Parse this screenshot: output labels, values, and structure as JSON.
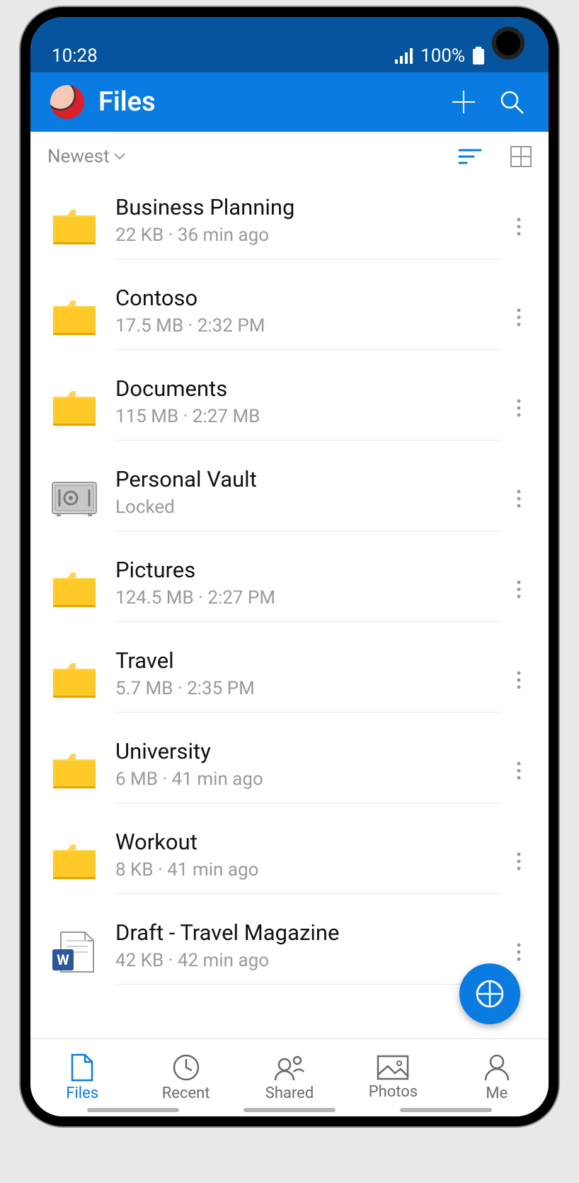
{
  "status": {
    "time": "10:28",
    "battery": "100%"
  },
  "header": {
    "title": "Files"
  },
  "sort": {
    "label": "Newest"
  },
  "files": [
    {
      "icon": "folder",
      "name": "Business Planning",
      "meta": "22 KB · 36 min ago"
    },
    {
      "icon": "folder",
      "name": "Contoso",
      "meta": "17.5 MB · 2:32 PM"
    },
    {
      "icon": "folder",
      "name": "Documents",
      "meta": "115 MB · 2:27 MB"
    },
    {
      "icon": "vault",
      "name": "Personal Vault",
      "meta": "Locked"
    },
    {
      "icon": "folder",
      "name": "Pictures",
      "meta": "124.5 MB · 2:27 PM"
    },
    {
      "icon": "folder",
      "name": "Travel",
      "meta": "5.7 MB · 2:35 PM"
    },
    {
      "icon": "folder",
      "name": "University",
      "meta": "6 MB · 41 min ago"
    },
    {
      "icon": "folder",
      "name": "Workout",
      "meta": "8 KB · 41 min ago"
    },
    {
      "icon": "word",
      "name": "Draft - Travel Magazine",
      "meta": "42 KB · 42 min ago"
    }
  ],
  "nav": {
    "files": "Files",
    "recent": "Recent",
    "shared": "Shared",
    "photos": "Photos",
    "me": "Me"
  }
}
